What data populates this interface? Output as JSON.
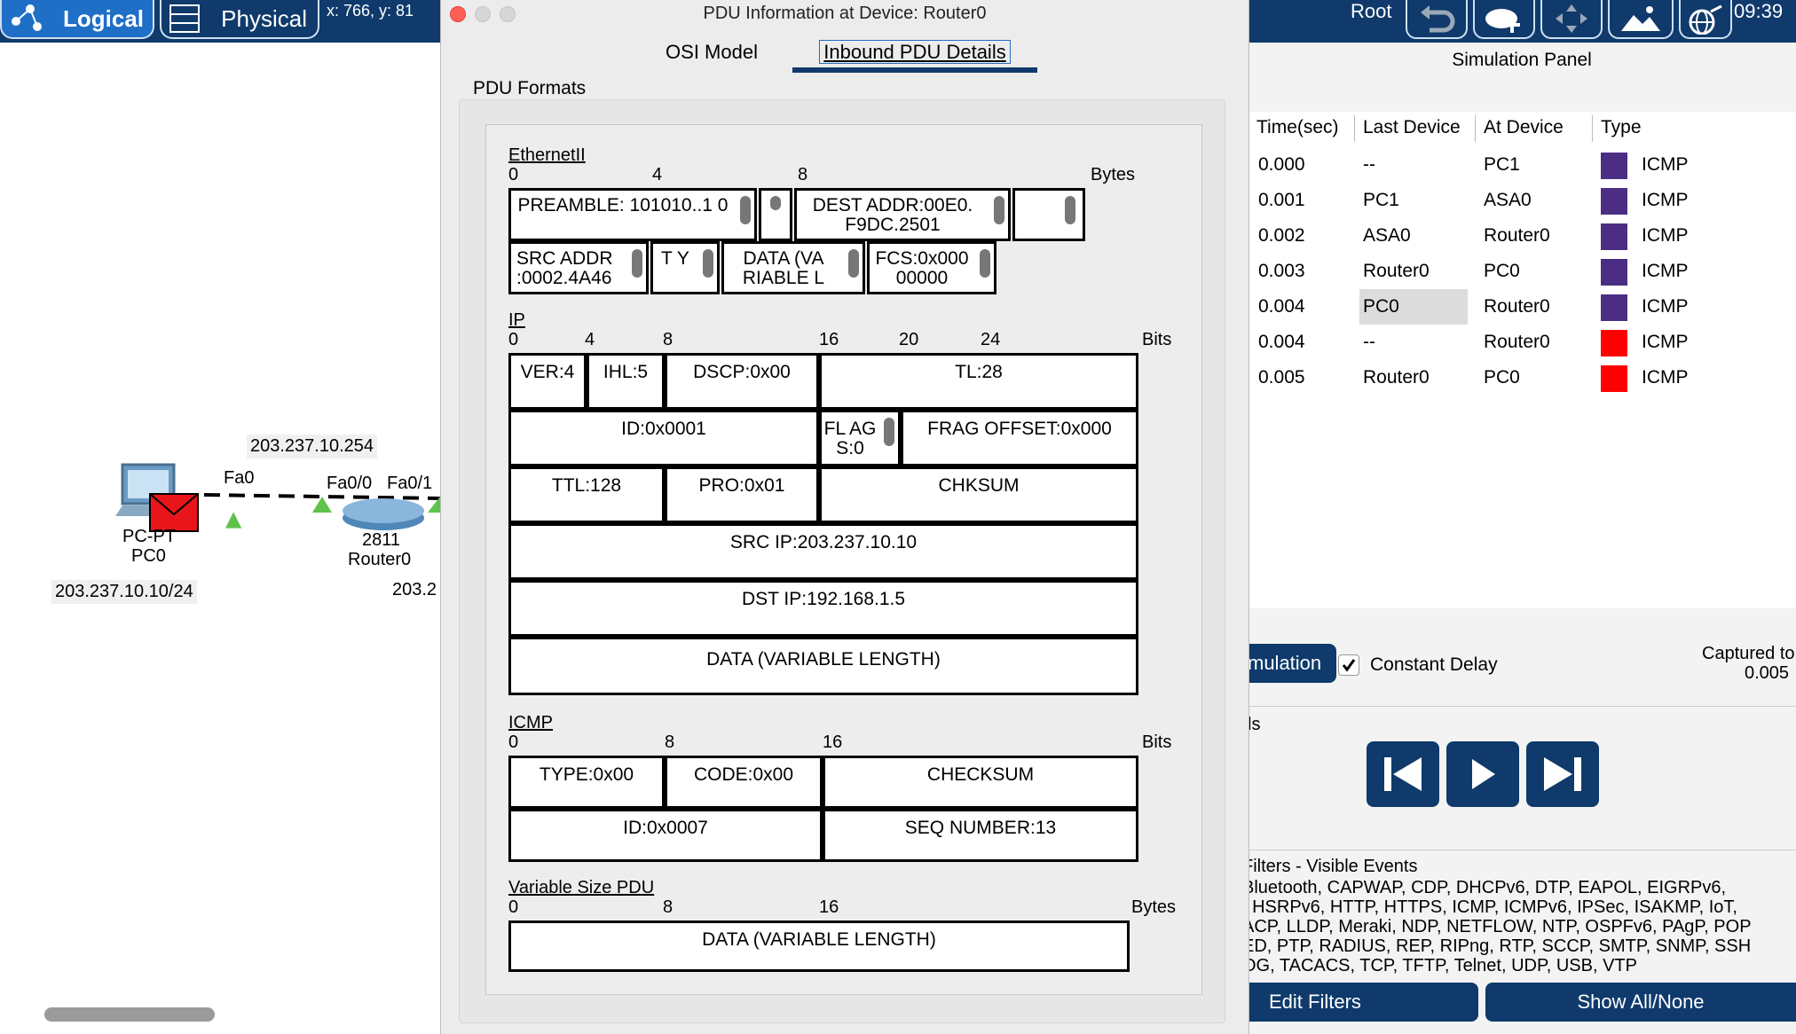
{
  "topbar": {
    "logical_label": "Logical",
    "physical_label": "Physical",
    "coords": "x: 766, y: 81",
    "root_label": "Root",
    "clock": "09:39"
  },
  "workspace": {
    "net_label_top": "203.237.10.254",
    "pc_port": "Fa0",
    "router_port_a": "Fa0/0",
    "router_port_b": "Fa0/1",
    "pc_model": "PC-PT",
    "pc_name": "PC0",
    "pc_ip": "203.237.10.10/24",
    "router_model": "2811",
    "router_name": "Router0",
    "router_ip_partial": "203.2"
  },
  "dialog": {
    "title": "PDU Information at Device: Router0",
    "tabs": [
      "OSI Model",
      "Inbound PDU Details"
    ],
    "section_title": "PDU Formats",
    "ethernet": {
      "label": "EthernetII",
      "unit": "Bytes",
      "ticks": [
        "0",
        "4",
        "8"
      ],
      "fields": {
        "preamble": "PREAMBLE: 101010..1 0",
        "dest": "DEST ADDR:00E0. F9DC.2501",
        "src": "SRC ADDR :0002.4A46",
        "type": "T Y",
        "data": "DATA (VA RIABLE L",
        "fcs": "FCS:0x000 00000"
      }
    },
    "ip": {
      "label": "IP",
      "unit": "Bits",
      "ticks": [
        "0",
        "4",
        "8",
        "16",
        "20",
        "24"
      ],
      "fields": {
        "ver": "VER:4",
        "ihl": "IHL:5",
        "dscp": "DSCP:0x00",
        "tl": "TL:28",
        "id": "ID:0x0001",
        "flags": "FL AG S:0",
        "frag": "FRAG OFFSET:0x000",
        "ttl": "TTL:128",
        "pro": "PRO:0x01",
        "chksum": "CHKSUM",
        "src": "SRC IP:203.237.10.10",
        "dst": "DST IP:192.168.1.5",
        "data": "DATA (VARIABLE LENGTH)"
      }
    },
    "icmp": {
      "label": "ICMP",
      "unit": "Bits",
      "ticks": [
        "0",
        "8",
        "16"
      ],
      "fields": {
        "type": "TYPE:0x00",
        "code": "CODE:0x00",
        "checksum": "CHECKSUM",
        "id": "ID:0x0007",
        "seq": "SEQ NUMBER:13"
      }
    },
    "vpdu": {
      "label": "Variable Size PDU",
      "unit": "Bytes",
      "ticks": [
        "0",
        "8",
        "16"
      ],
      "data": "DATA (VARIABLE LENGTH)"
    }
  },
  "sim": {
    "title": "Simulation Panel",
    "columns": [
      "Time(sec)",
      "Last Device",
      "At Device",
      "Type"
    ],
    "rows": [
      {
        "time": "0.000",
        "last": "--",
        "at": "PC1",
        "type": "ICMP",
        "color": "#4b2e83"
      },
      {
        "time": "0.001",
        "last": "PC1",
        "at": "ASA0",
        "type": "ICMP",
        "color": "#4b2e83"
      },
      {
        "time": "0.002",
        "last": "ASA0",
        "at": "Router0",
        "type": "ICMP",
        "color": "#4b2e83"
      },
      {
        "time": "0.003",
        "last": "Router0",
        "at": "PC0",
        "type": "ICMP",
        "color": "#4b2e83"
      },
      {
        "time": "0.004",
        "last": "PC0",
        "at": "Router0",
        "type": "ICMP",
        "color": "#4b2e83"
      },
      {
        "time": "0.004",
        "last": "--",
        "at": "Router0",
        "type": "ICMP",
        "color": "#ff0000"
      },
      {
        "time": "0.005",
        "last": "Router0",
        "at": "PC0",
        "type": "ICMP",
        "color": "#ff0000"
      }
    ],
    "sim_button": "mulation",
    "constant_delay": "Constant Delay",
    "captured_line1": "Captured to",
    "captured_line2": "0.005",
    "controls_label": "ls",
    "filters_title": "Filters - Visible Events",
    "filters_lines": [
      "Bluetooth, CAPWAP, CDP, DHCPv6, DTP, EAPOL, EIGRPv6,",
      ", HSRPv6, HTTP, HTTPS, ICMP, ICMPv6, IPSec, ISAKMP, IoT,",
      "ACP, LLDP, Meraki, NDP, NETFLOW, NTP, OSPFv6, PAgP, POP",
      "ED, PTP, RADIUS, REP, RIPng, RTP, SCCP, SMTP, SNMP, SSH",
      "OG, TACACS, TCP, TFTP, Telnet, UDP, USB, VTP"
    ],
    "edit_filters": "Edit Filters",
    "show_all": "Show All/None"
  }
}
